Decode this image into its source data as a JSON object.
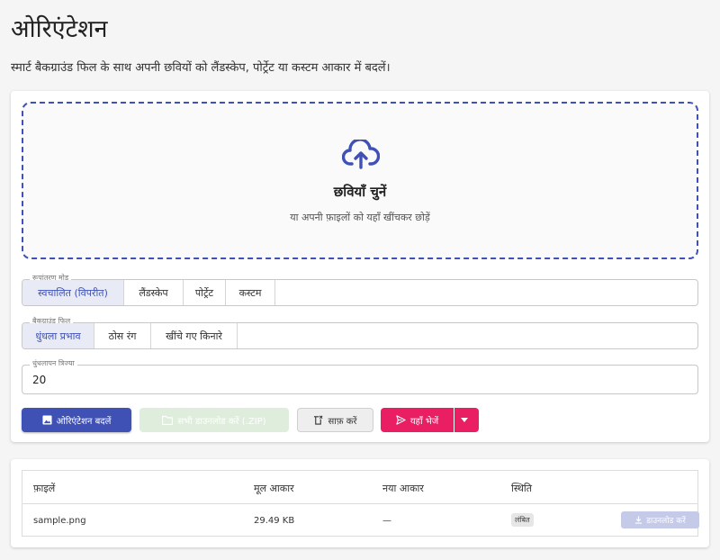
{
  "page": {
    "title": "ओरिएंटेशन",
    "subtitle": "स्मार्ट बैकग्राउंड फिल के साथ अपनी छवियों को लैंडस्केप, पोर्ट्रेट या कस्टम आकार में बदलें।"
  },
  "upload": {
    "icon": "cloud-upload-icon",
    "title": "छवियाँ चुनें",
    "hint": "या अपनी फ़ाइलों को यहाँ खींचकर छोड़ें"
  },
  "transform_mode": {
    "legend": "रूपांतरण मोड",
    "options": [
      "स्वचालित (विपरीत)",
      "लैंडस्केप",
      "पोर्ट्रेट",
      "कस्टम"
    ],
    "selected": "स्वचालित (विपरीत)"
  },
  "background_fill": {
    "legend": "बैकग्राउंड फिल",
    "options": [
      "धुंधला प्रभाव",
      "ठोस रंग",
      "खींचे गए किनारे"
    ],
    "selected": "धुंधला प्रभाव"
  },
  "blur_radius": {
    "label": "धुंधलापन त्रिज्या",
    "value": "20"
  },
  "actions": {
    "change_orientation": "ओरिएंटेशन बदलें",
    "download_all": "सभी डाउनलोड करें (.ZIP)",
    "clear": "साफ़ करें",
    "send_here": "यहाँ भेजें"
  },
  "table": {
    "headers": [
      "फ़ाइलें",
      "मूल आकार",
      "नया आकार",
      "स्थिति"
    ],
    "rows": [
      {
        "file": "sample.png",
        "original_size": "29.49 KB",
        "new_size": "—",
        "status": "लंबित",
        "download": "डाउनलोड करें"
      }
    ]
  },
  "colors": {
    "primary": "#3f51b5",
    "accent": "#e91e63",
    "disabled_success": "#dfeedc"
  }
}
